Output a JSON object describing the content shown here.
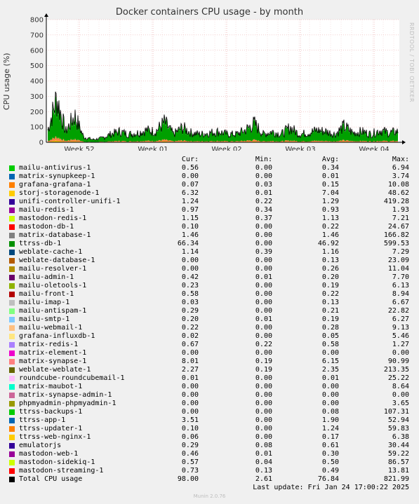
{
  "chart_data": {
    "type": "area",
    "title": "Docker containers CPU usage - by month",
    "ylabel": "CPU usage (%)",
    "xlabel": "",
    "ylim": [
      0,
      800
    ],
    "yticks": [
      0,
      100,
      200,
      300,
      400,
      500,
      600,
      700,
      800
    ],
    "xticks": [
      "Week 52",
      "Week 01",
      "Week 02",
      "Week 03",
      "Week 04"
    ],
    "grid": true,
    "stacked": true,
    "x_range": [
      "Week 52 start",
      "Week 04 end"
    ],
    "series_profile": {
      "total_approx": [
        90,
        330,
        80,
        200,
        40,
        20,
        30,
        60,
        80,
        60,
        70,
        90,
        80,
        150,
        60,
        110,
        70,
        60,
        70,
        80,
        60,
        60,
        90,
        140,
        60,
        80,
        60,
        110,
        60,
        70,
        90,
        80,
        60,
        120,
        70,
        80,
        60,
        90,
        70,
        80
      ],
      "base_colors": [
        "#00a000",
        "#f0c000",
        "#ff8040",
        "#7f7f7f"
      ]
    },
    "legend_headers": {
      "cur": "Cur:",
      "min": "Min:",
      "avg": "Avg:",
      "max": "Max:"
    },
    "series": [
      {
        "name": "mailu-antivirus-1",
        "color": "#00cc00",
        "cur": "0.56",
        "min": "0.00",
        "avg": "0.34",
        "max": "6.94"
      },
      {
        "name": "matrix-synupkeep-1",
        "color": "#0066b3",
        "cur": "0.00",
        "min": "0.00",
        "avg": "0.01",
        "max": "3.74"
      },
      {
        "name": "grafana-grafana-1",
        "color": "#ff8000",
        "cur": "0.07",
        "min": "0.03",
        "avg": "0.15",
        "max": "10.08"
      },
      {
        "name": "storj-storagenode-1",
        "color": "#ffcc00",
        "cur": "6.32",
        "min": "0.01",
        "avg": "7.04",
        "max": "48.62"
      },
      {
        "name": "unifi-controller-unifi-1",
        "color": "#330099",
        "cur": "1.24",
        "min": "0.22",
        "avg": "1.29",
        "max": "419.28"
      },
      {
        "name": "mailu-redis-1",
        "color": "#990099",
        "cur": "0.97",
        "min": "0.34",
        "avg": "0.93",
        "max": "1.93"
      },
      {
        "name": "mastodon-redis-1",
        "color": "#ccff00",
        "cur": "1.15",
        "min": "0.37",
        "avg": "1.13",
        "max": "7.21"
      },
      {
        "name": "mastodon-db-1",
        "color": "#ff0000",
        "cur": "0.10",
        "min": "0.00",
        "avg": "0.22",
        "max": "24.67"
      },
      {
        "name": "matrix-database-1",
        "color": "#808080",
        "cur": "1.46",
        "min": "0.00",
        "avg": "1.46",
        "max": "166.82"
      },
      {
        "name": "ttrss-db-1",
        "color": "#008f00",
        "cur": "66.34",
        "min": "0.00",
        "avg": "46.92",
        "max": "599.53"
      },
      {
        "name": "weblate-cache-1",
        "color": "#00487d",
        "cur": "1.14",
        "min": "0.39",
        "avg": "1.16",
        "max": "7.29"
      },
      {
        "name": "weblate-database-1",
        "color": "#b35a00",
        "cur": "0.00",
        "min": "0.00",
        "avg": "0.13",
        "max": "23.09"
      },
      {
        "name": "mailu-resolver-1",
        "color": "#b38f00",
        "cur": "0.00",
        "min": "0.00",
        "avg": "0.26",
        "max": "11.04"
      },
      {
        "name": "mailu-admin-1",
        "color": "#6b006b",
        "cur": "0.42",
        "min": "0.01",
        "avg": "0.20",
        "max": "7.70"
      },
      {
        "name": "mailu-oletools-1",
        "color": "#8fb300",
        "cur": "0.23",
        "min": "0.00",
        "avg": "0.19",
        "max": "6.13"
      },
      {
        "name": "mailu-front-1",
        "color": "#b30000",
        "cur": "0.58",
        "min": "0.00",
        "avg": "0.22",
        "max": "8.94"
      },
      {
        "name": "mailu-imap-1",
        "color": "#bebebe",
        "cur": "0.03",
        "min": "0.00",
        "avg": "0.13",
        "max": "6.67"
      },
      {
        "name": "mailu-antispam-1",
        "color": "#80ff80",
        "cur": "0.29",
        "min": "0.00",
        "avg": "0.21",
        "max": "22.82"
      },
      {
        "name": "mailu-smtp-1",
        "color": "#80c9ff",
        "cur": "0.20",
        "min": "0.01",
        "avg": "0.19",
        "max": "6.27"
      },
      {
        "name": "mailu-webmail-1",
        "color": "#ffc080",
        "cur": "0.22",
        "min": "0.00",
        "avg": "0.28",
        "max": "9.13"
      },
      {
        "name": "grafana-influxdb-1",
        "color": "#ffe680",
        "cur": "0.02",
        "min": "0.00",
        "avg": "0.05",
        "max": "5.46"
      },
      {
        "name": "matrix-redis-1",
        "color": "#aa80ff",
        "cur": "0.67",
        "min": "0.22",
        "avg": "0.58",
        "max": "1.27"
      },
      {
        "name": "matrix-element-1",
        "color": "#ee00cc",
        "cur": "0.00",
        "min": "0.00",
        "avg": "0.00",
        "max": "0.00"
      },
      {
        "name": "matrix-synapse-1",
        "color": "#ff8080",
        "cur": "8.01",
        "min": "0.19",
        "avg": "6.15",
        "max": "90.99"
      },
      {
        "name": "weblate-weblate-1",
        "color": "#666600",
        "cur": "2.27",
        "min": "0.19",
        "avg": "2.35",
        "max": "213.35"
      },
      {
        "name": "roundcube-roundcubemail-1",
        "color": "#ffbfff",
        "cur": "0.01",
        "min": "0.00",
        "avg": "0.01",
        "max": "25.22"
      },
      {
        "name": "matrix-maubot-1",
        "color": "#00ffcc",
        "cur": "0.00",
        "min": "0.00",
        "avg": "0.00",
        "max": "8.64"
      },
      {
        "name": "matrix-synapse-admin-1",
        "color": "#cc6699",
        "cur": "0.00",
        "min": "0.00",
        "avg": "0.00",
        "max": "0.00"
      },
      {
        "name": "phpmyadmin-phpmyadmin-1",
        "color": "#999900",
        "cur": "0.00",
        "min": "0.00",
        "avg": "0.00",
        "max": "3.65"
      },
      {
        "name": "ttrss-backups-1",
        "color": "#00cc00",
        "cur": "0.00",
        "min": "0.00",
        "avg": "0.08",
        "max": "107.31"
      },
      {
        "name": "ttrss-app-1",
        "color": "#0066b3",
        "cur": "3.51",
        "min": "0.00",
        "avg": "1.90",
        "max": "52.94"
      },
      {
        "name": "ttrss-updater-1",
        "color": "#ff8000",
        "cur": "0.10",
        "min": "0.00",
        "avg": "1.24",
        "max": "59.83"
      },
      {
        "name": "ttrss-web-nginx-1",
        "color": "#ffcc00",
        "cur": "0.06",
        "min": "0.00",
        "avg": "0.17",
        "max": "6.38"
      },
      {
        "name": "emulatorjs",
        "color": "#330099",
        "cur": "0.29",
        "min": "0.08",
        "avg": "0.61",
        "max": "30.44"
      },
      {
        "name": "mastodon-web-1",
        "color": "#990099",
        "cur": "0.46",
        "min": "0.01",
        "avg": "0.30",
        "max": "59.22"
      },
      {
        "name": "mastodon-sidekiq-1",
        "color": "#ccff00",
        "cur": "0.57",
        "min": "0.04",
        "avg": "0.50",
        "max": "86.57"
      },
      {
        "name": "mastodon-streaming-1",
        "color": "#ff0000",
        "cur": "0.73",
        "min": "0.13",
        "avg": "0.49",
        "max": "13.81"
      },
      {
        "name": "Total CPU usage",
        "color": "#000000",
        "cur": "98.00",
        "min": "2.61",
        "avg": "76.84",
        "max": "821.99"
      }
    ]
  },
  "last_update": "Last update: Fri Jan 24 17:00:22 2025",
  "watermark": "RRDTOOL / TOBI OETIKER",
  "footer": "Munin 2.0.76"
}
